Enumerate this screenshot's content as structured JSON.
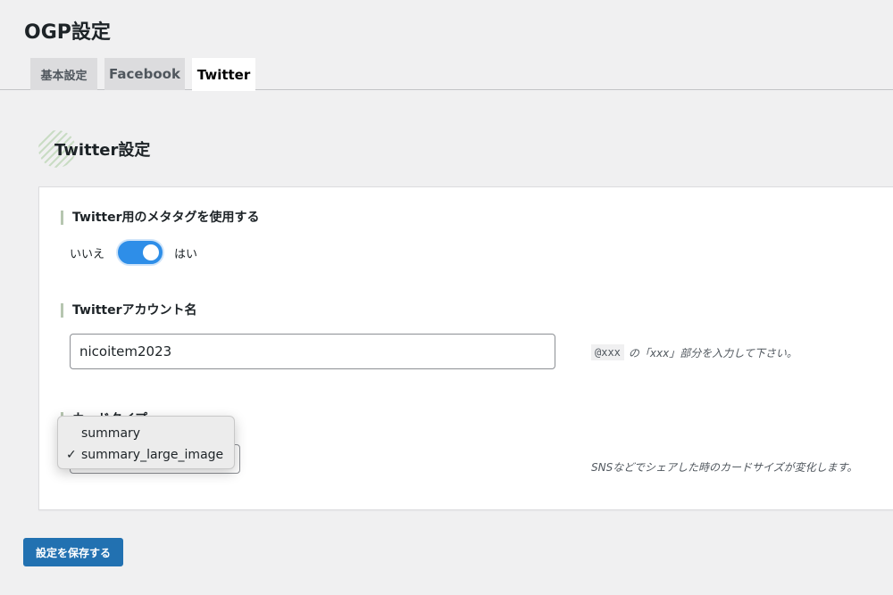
{
  "page": {
    "title": "OGP設定"
  },
  "tabs": [
    {
      "label": "基本設定",
      "active": false
    },
    {
      "label": "Facebook",
      "active": false
    },
    {
      "label": "Twitter",
      "active": true
    }
  ],
  "section": {
    "title": "Twitter設定"
  },
  "fields": {
    "meta_tag": {
      "label": "Twitter用のメタタグを使用する",
      "off_label": "いいえ",
      "on_label": "はい",
      "value": true
    },
    "account": {
      "label": "Twitterアカウント名",
      "value": "nicoitem2023",
      "help_code": "@xxx",
      "help_text": "の「xxx」部分を入力して下さい。"
    },
    "card_type": {
      "label": "カードタイプ",
      "help_text": "SNSなどでシェアした時のカードサイズが変化します。",
      "options": [
        "summary",
        "summary_large_image"
      ],
      "selected": "summary_large_image",
      "check_mark": "✓"
    }
  },
  "actions": {
    "save_label": "設定を保存する"
  },
  "colors": {
    "accent": "#2271b1",
    "toggle_on": "#2e8ee8",
    "label_bar": "#b6c6b0"
  }
}
